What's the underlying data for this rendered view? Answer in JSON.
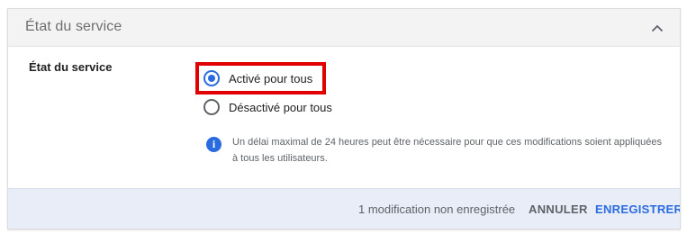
{
  "header": {
    "title": "État du service",
    "collapse_icon": "chevron-up-icon"
  },
  "section": {
    "label": "État du service",
    "options": [
      {
        "label": "Activé pour tous",
        "selected": true
      },
      {
        "label": "Désactivé pour tous",
        "selected": false
      }
    ],
    "info_icon": "info-icon",
    "info_text": "Un délai maximal de 24 heures peut être nécessaire pour que ces modifications soient appliquées à tous les utilisateurs."
  },
  "footer": {
    "unsaved_text": "1 modification non enregistrée",
    "cancel_label": "ANNULER",
    "save_label": "ENREGISTRER"
  },
  "colors": {
    "accent": "#2a6be0",
    "highlight": "#e00000",
    "footer_bg": "#e8edf8"
  }
}
